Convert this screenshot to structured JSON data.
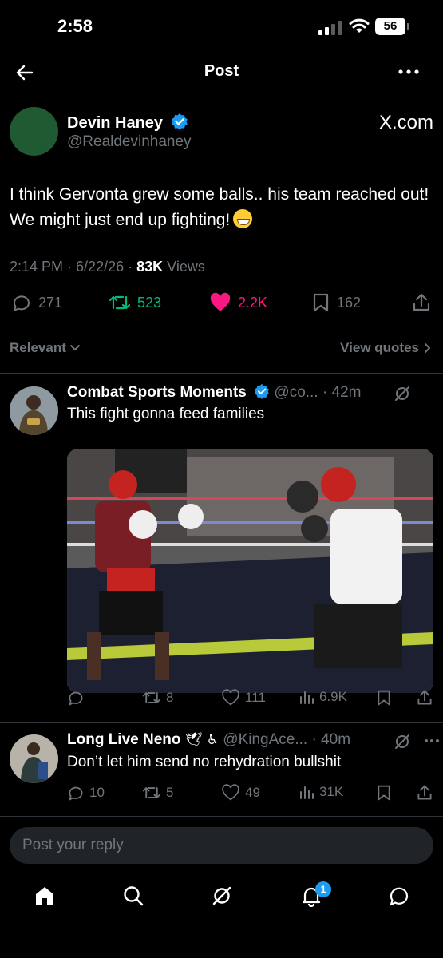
{
  "status": {
    "time": "2:58",
    "battery": "56"
  },
  "header": {
    "title": "Post"
  },
  "post": {
    "author_name": "Devin Haney",
    "author_handle": "@Realdevinhaney",
    "source": "X.com",
    "text": "I think Gervonta grew some balls.. his team reached out! We might just end up fighting!",
    "emoji_icon": "grinning-sweat-emoji",
    "time": "2:14 PM",
    "date": "6/22/26",
    "views_count": "83K",
    "views_label": "Views",
    "replies": "271",
    "reposts": "523",
    "likes": "2.2K",
    "bookmarks": "162"
  },
  "sort": {
    "label": "Relevant",
    "view_quotes": "View quotes"
  },
  "replies": [
    {
      "name": "Combat Sports Moments",
      "handle": "@co...",
      "age": "42m",
      "text": "This fight gonna feed families",
      "replies": "",
      "reposts": "8",
      "likes": "111",
      "views": "6.9K"
    },
    {
      "name": "Long Live Neno",
      "name_emoji": "🕊 ♿",
      "handle": "@KingAce...",
      "age": "40m",
      "text": "Don’t let him send no rehydration bullshit",
      "replies": "10",
      "reposts": "5",
      "likes": "49",
      "views": "31K"
    }
  ],
  "composer": {
    "placeholder": "Post your reply"
  },
  "tabs": {
    "notifications_badge": "1"
  },
  "colors": {
    "accent": "#1d9bf0",
    "repost": "#00ba7c",
    "like": "#f91880",
    "muted": "#71767b"
  }
}
